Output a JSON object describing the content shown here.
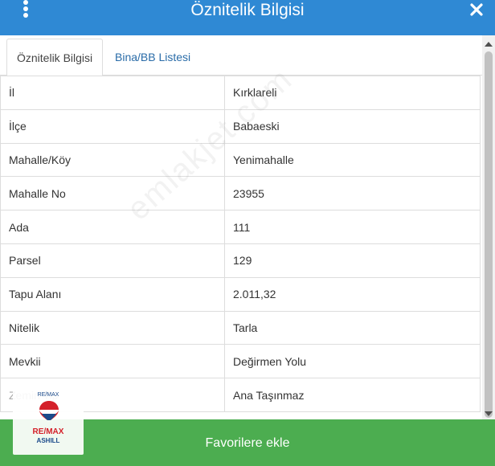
{
  "header": {
    "title": "Öznitelik Bilgisi",
    "icons": {
      "menu": "kebab-menu-icon",
      "close": "close-icon"
    },
    "colors": {
      "background": "#2f89d4",
      "text": "#ffffff"
    }
  },
  "tabs": [
    {
      "label": "Öznitelik Bilgisi",
      "active": true
    },
    {
      "label": "Bina/BB Listesi",
      "active": false
    }
  ],
  "table": {
    "rows": [
      {
        "key": "İl",
        "value": "Kırklareli"
      },
      {
        "key": "İlçe",
        "value": "Babaeski"
      },
      {
        "key": "Mahalle/Köy",
        "value": "Yenimahalle"
      },
      {
        "key": "Mahalle No",
        "value": "23955"
      },
      {
        "key": "Ada",
        "value": "111"
      },
      {
        "key": "Parsel",
        "value": "129"
      },
      {
        "key": "Tapu Alanı",
        "value": "2.011,32"
      },
      {
        "key": "Nitelik",
        "value": "Tarla"
      },
      {
        "key": "Mevkii",
        "value": "Değirmen Yolu"
      },
      {
        "key": "Zemin Tip",
        "value": "Ana Taşınmaz"
      }
    ]
  },
  "footer": {
    "button_label": "Favorilere ekle",
    "color": "#4cad50"
  },
  "watermark": {
    "text": "emlakjet.com"
  },
  "logo": {
    "top": "RE/MAX",
    "brand": "RE/MAX",
    "sub": "ASHILL"
  }
}
